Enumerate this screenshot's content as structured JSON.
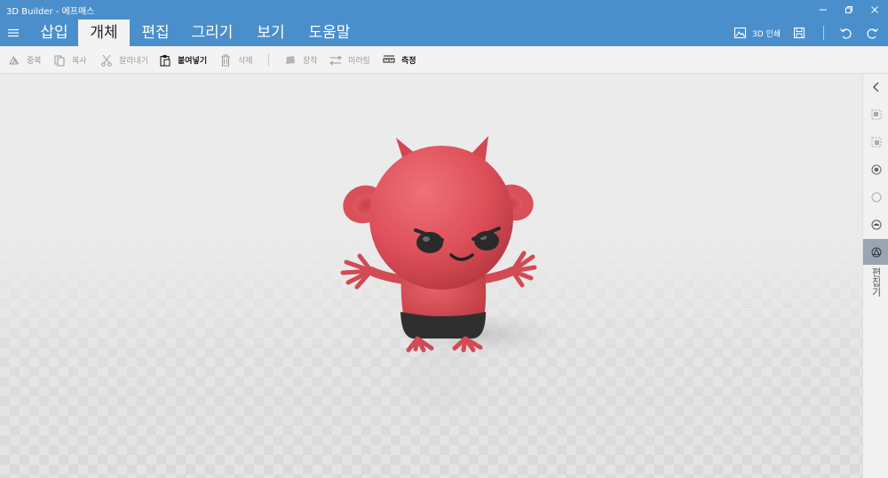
{
  "window": {
    "title": "3D Builder - 에프매스"
  },
  "ribbon": {
    "tabs": [
      {
        "label": "삽입",
        "active": false
      },
      {
        "label": "개체",
        "active": true
      },
      {
        "label": "편집",
        "active": false
      },
      {
        "label": "그리기",
        "active": false
      },
      {
        "label": "보기",
        "active": false
      },
      {
        "label": "도움말",
        "active": false
      }
    ],
    "print_label": "3D 인쇄"
  },
  "toolbar": {
    "items": [
      {
        "label": "중복",
        "enabled": false,
        "icon": "duplicate-icon"
      },
      {
        "label": "복사",
        "enabled": false,
        "icon": "copy-icon"
      },
      {
        "label": "잘라내기",
        "enabled": false,
        "icon": "scissors-icon"
      },
      {
        "label": "붙여넣기",
        "enabled": true,
        "icon": "paste-icon"
      },
      {
        "label": "삭제",
        "enabled": false,
        "icon": "trash-icon"
      },
      {
        "label": "장착",
        "enabled": false,
        "icon": "settle-icon"
      },
      {
        "label": "미러링",
        "enabled": false,
        "icon": "mirror-icon"
      },
      {
        "label": "측정",
        "enabled": true,
        "icon": "measure-icon"
      }
    ]
  },
  "rightpanel": {
    "label": "편집기",
    "buttons": [
      {
        "icon": "collapse-icon"
      },
      {
        "icon": "select-object-icon"
      },
      {
        "icon": "select-face-icon"
      },
      {
        "icon": "color-icon"
      },
      {
        "icon": "circle-icon"
      },
      {
        "icon": "texture-icon"
      },
      {
        "icon": "materials-icon",
        "selected": true
      }
    ]
  },
  "colors": {
    "accent": "#4a8fcc",
    "model": "#e0525b",
    "model_dark": "#b8363f",
    "shorts": "#2e2e2e"
  }
}
